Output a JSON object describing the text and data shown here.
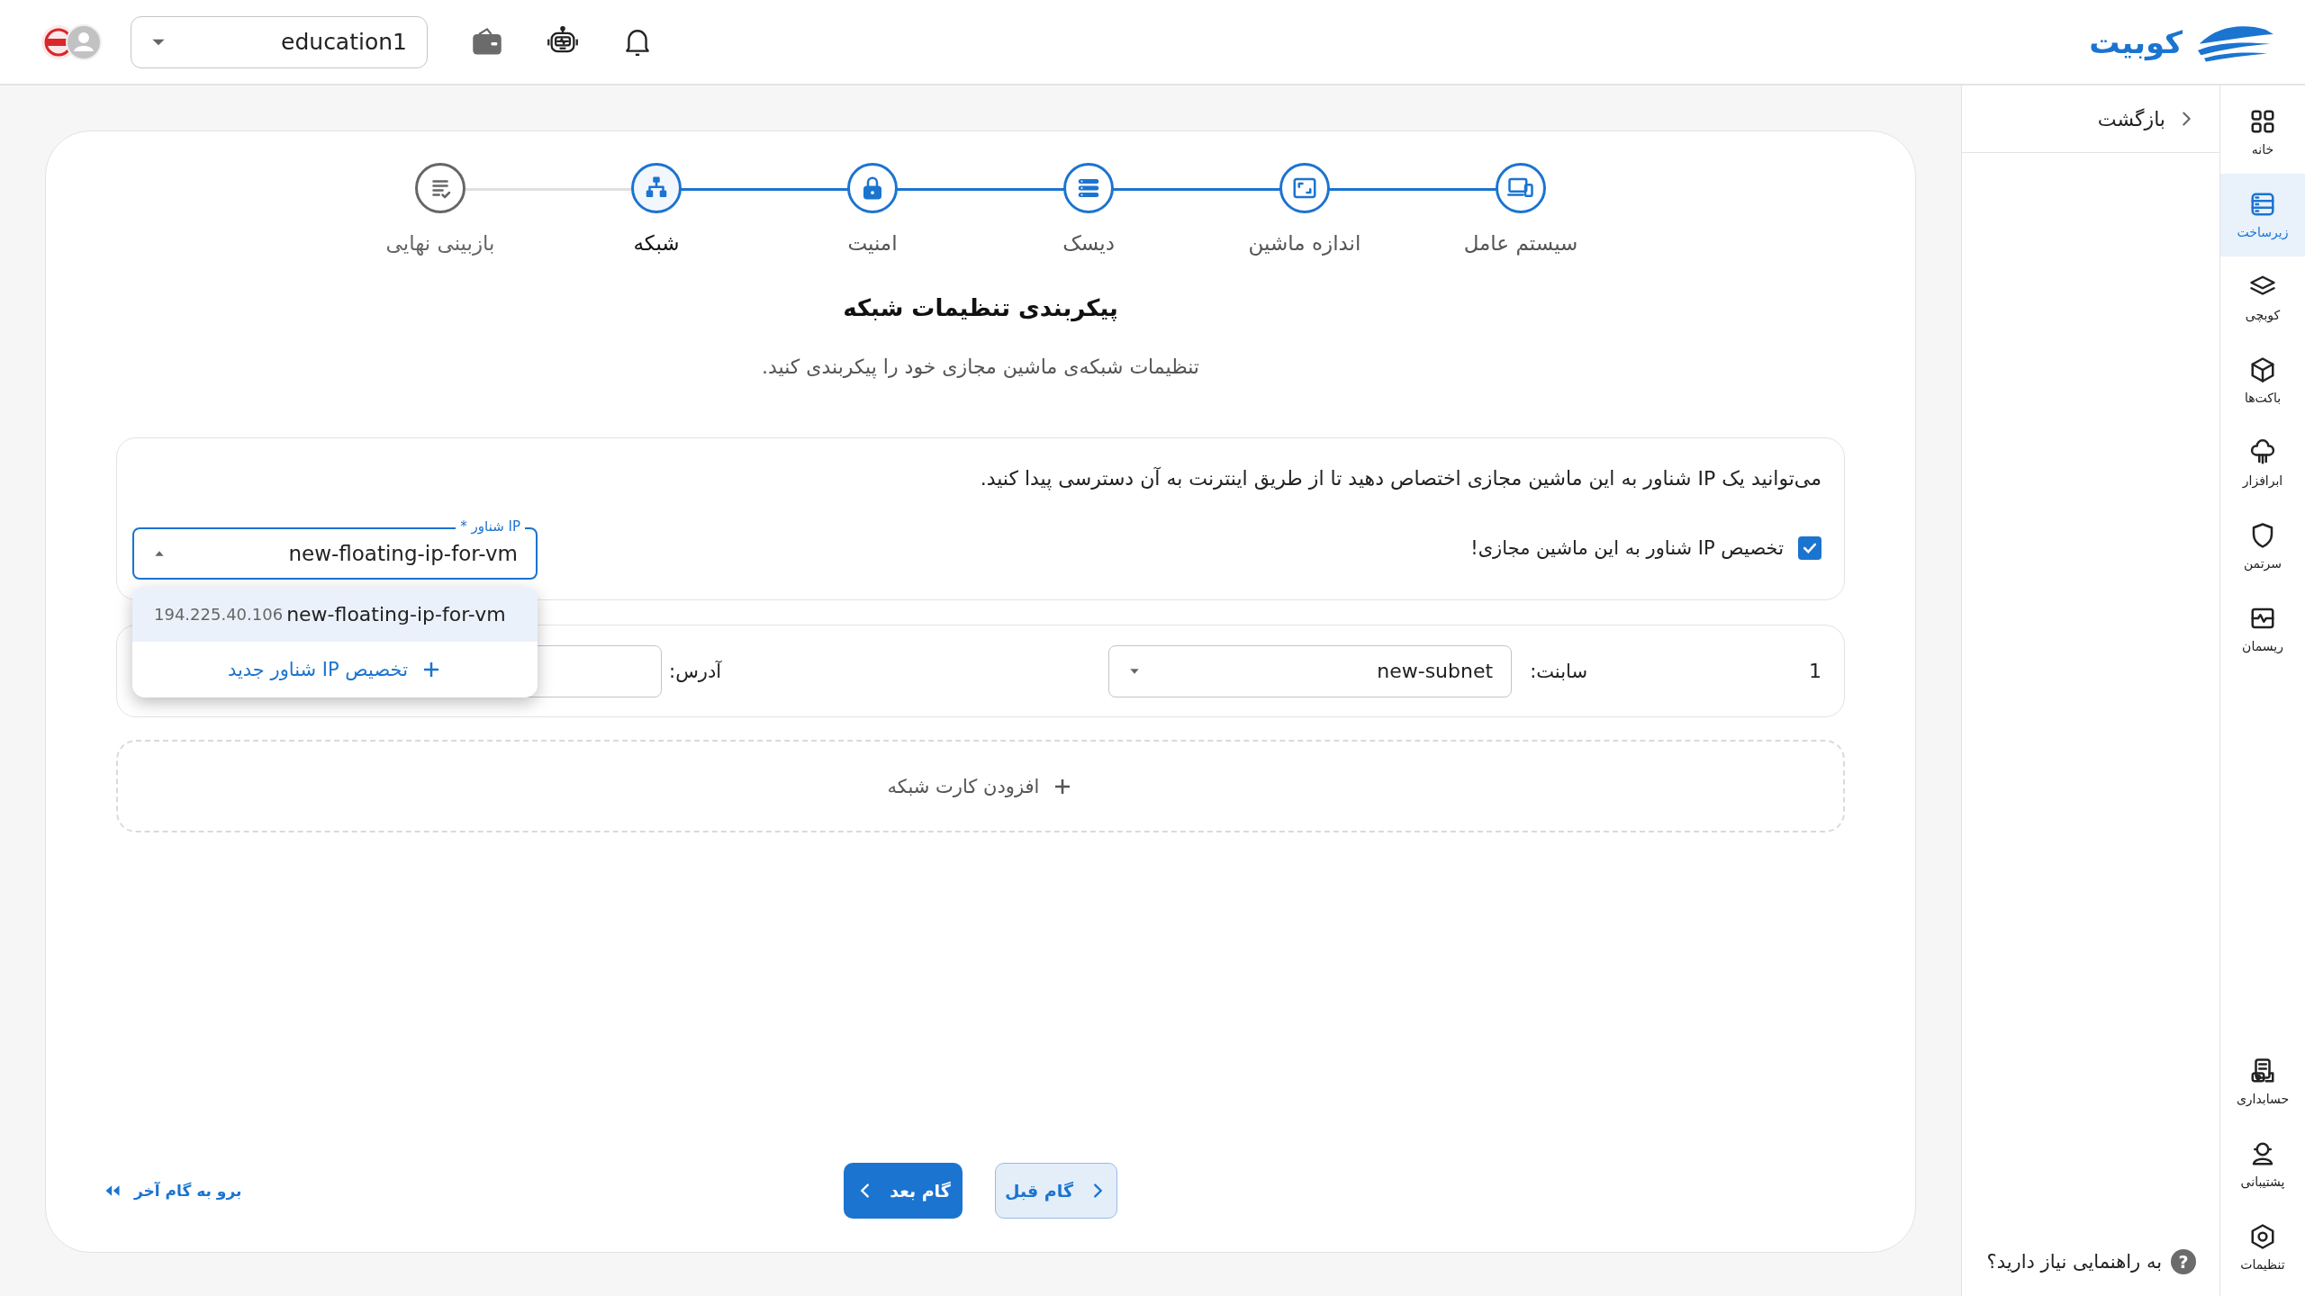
{
  "topbar": {
    "brand": "کوبیت",
    "project_select": {
      "value": "education1"
    }
  },
  "sidebar": {
    "items": [
      {
        "label": "خانه",
        "selected": false
      },
      {
        "label": "زیرساخت",
        "selected": true
      },
      {
        "label": "کوبچی",
        "selected": false
      },
      {
        "label": "باکت‌ها",
        "selected": false
      },
      {
        "label": "ابرافزار",
        "selected": false
      },
      {
        "label": "سرتمن",
        "selected": false
      },
      {
        "label": "ریسمان",
        "selected": false
      }
    ],
    "bottom_items": [
      {
        "label": "حسابداری",
        "selected": false
      },
      {
        "label": "پشتیبانی",
        "selected": false
      },
      {
        "label": "تنظیمات",
        "selected": false
      }
    ]
  },
  "side_panel": {
    "back": "بازگشت",
    "help": {
      "icon": "?",
      "text": "به راهنمایی نیاز دارید؟"
    }
  },
  "stepper": {
    "steps": [
      {
        "label": "سیستم عامل",
        "completed": true,
        "selected": false
      },
      {
        "label": "اندازه ماشین",
        "completed": true,
        "selected": false
      },
      {
        "label": "دیسک",
        "completed": true,
        "selected": false
      },
      {
        "label": "امنیت",
        "completed": true,
        "selected": false
      },
      {
        "label": "شبکه",
        "completed": false,
        "selected": true
      },
      {
        "label": "بازبینی نهایی",
        "completed": false,
        "selected": false
      }
    ]
  },
  "title": "پیکربندی تنظیمات شبکه",
  "subtitle": "تنظیمات شبکه‌ی ماشین مجازی خود را پیکربندی کنید.",
  "floating_ip": {
    "description": "می‌توانید یک IP شناور به این ماشین مجازی اختصاص دهید تا از طریق اینترنت به آن دسترسی پیدا کنید.",
    "checkbox": {
      "label": "تخصیص IP شناور به این ماشین مجازی!",
      "checked": true
    },
    "select": {
      "label": "IP شناور *",
      "value": "new-floating-ip-for-vm",
      "expanded": true
    },
    "options": [
      {
        "address": "194.225.40.106",
        "name": "new-floating-ip-for-vm",
        "selected": true
      }
    ],
    "add_option": "تخصیص IP شناور جدید"
  },
  "network_cards": [
    {
      "index": "1",
      "subnet_label": "سابنت:",
      "subnet": "new-subnet",
      "address_label": "آدرس:"
    }
  ],
  "add_network_card": "افزودن کارت شبکه",
  "footer": {
    "previous": "گام قبل",
    "next": "گام بعد",
    "last_step": "برو به گام آخر"
  }
}
